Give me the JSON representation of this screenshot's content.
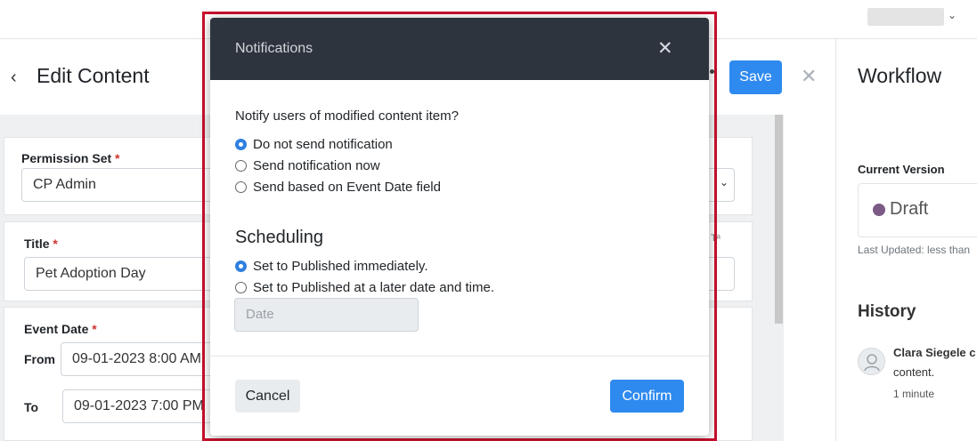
{
  "header": {
    "back_icon": "chevron-left-icon",
    "title": "Edit Content",
    "save_label": "Save",
    "close_icon": "close-icon"
  },
  "form": {
    "permission_set": {
      "label": "Permission Set",
      "required_mark": "*",
      "value": "CP Admin"
    },
    "title": {
      "label": "Title",
      "required_mark": "*",
      "value": "Pet Adoption Day"
    },
    "event_date": {
      "label": "Event Date",
      "required_mark": "*",
      "from_label": "From",
      "from_value": "09-01-2023 8:00 AM",
      "to_label": "To",
      "to_value": "09-01-2023 7:00 PM"
    }
  },
  "workflow": {
    "title": "Workflow",
    "current_version_label": "Current Version",
    "status": "Draft",
    "status_color": "#7b5a86",
    "last_updated": "Last Updated: less than",
    "history_title": "History",
    "history": [
      {
        "user": "Clara Siegele c",
        "text": "content.",
        "time": "1 minute"
      }
    ]
  },
  "modal": {
    "title": "Notifications",
    "close_icon": "close-icon",
    "prompt": "Notify users of modified content item?",
    "notify_options": [
      {
        "label": "Do not send notification",
        "checked": true
      },
      {
        "label": "Send notification now",
        "checked": false
      },
      {
        "label": "Send based on Event Date field",
        "checked": false
      }
    ],
    "scheduling_title": "Scheduling",
    "schedule_options": [
      {
        "label": "Set to Published immediately.",
        "checked": true
      },
      {
        "label": "Set to Published at a later date and time.",
        "checked": false
      }
    ],
    "date_placeholder": "Date",
    "cancel_label": "Cancel",
    "confirm_label": "Confirm"
  },
  "colors": {
    "accent": "#2f8af0",
    "modal_header": "#2d343d",
    "highlight": "#c8102e"
  }
}
